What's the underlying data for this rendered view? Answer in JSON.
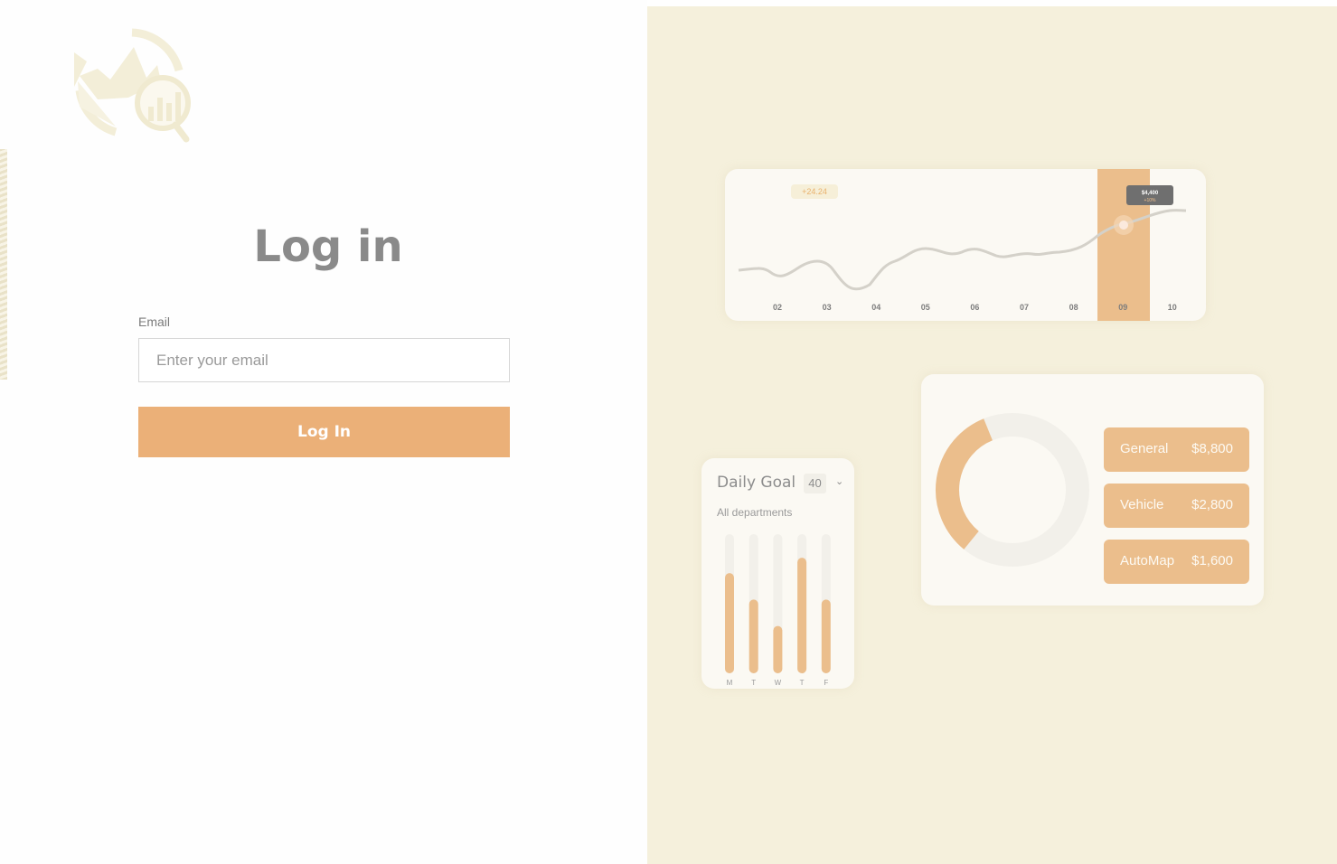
{
  "login": {
    "title": "Log in",
    "email_label": "Email",
    "email_placeholder": "Enter your email",
    "email_value": "",
    "submit_label": "Log In"
  },
  "colors": {
    "accent": "#ebb078",
    "panel_bg": "#f5f0dc",
    "title_gray": "#8a8a8a"
  },
  "illustration": {
    "line_chart": {
      "badge": "+24.24",
      "tooltip_value": "$4,400",
      "tooltip_delta": "+10%",
      "highlight": "09"
    },
    "daily_goal": {
      "title": "Daily Goal",
      "value": "40",
      "subtitle": "All departments"
    },
    "donut": {
      "items": [
        {
          "name": "General",
          "value": "$8,800"
        },
        {
          "name": "Vehicle",
          "value": "$2,800"
        },
        {
          "name": "AutoMap",
          "value": "$1,600"
        }
      ]
    }
  },
  "chart_data": [
    {
      "type": "line",
      "x": [
        "02",
        "03",
        "04",
        "05",
        "06",
        "07",
        "08",
        "09",
        "10"
      ],
      "series": [
        {
          "values": [
            1.0,
            1.6,
            0.4,
            2.4,
            2.6,
            2.2,
            2.3,
            4.4,
            5.0
          ]
        }
      ],
      "annotations": [
        "+24.24",
        "$4,400",
        "+10%"
      ]
    },
    {
      "type": "bar",
      "title": "Daily Goal",
      "categories": [
        "M",
        "T",
        "W",
        "T",
        "F"
      ],
      "values": [
        0.72,
        0.53,
        0.34,
        0.83,
        0.53
      ],
      "ylim": [
        0,
        1
      ]
    },
    {
      "type": "pie",
      "categories": [
        "General",
        "Vehicle",
        "AutoMap"
      ],
      "values": [
        8800,
        2800,
        1600
      ]
    }
  ]
}
